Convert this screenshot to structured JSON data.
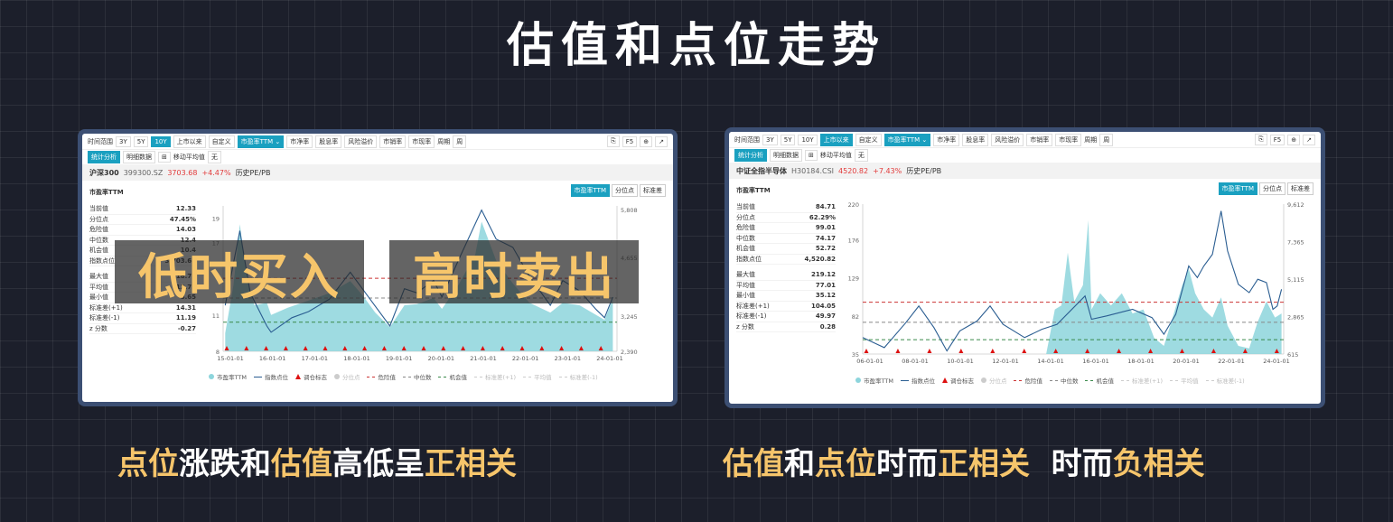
{
  "title": "估值和点位走势",
  "captions": {
    "left": [
      {
        "text": "点位",
        "hl": true
      },
      {
        "text": "涨跌和",
        "hl": false
      },
      {
        "text": "估值",
        "hl": true
      },
      {
        "text": "高低呈",
        "hl": false
      },
      {
        "text": "正相关",
        "hl": true
      }
    ],
    "right": [
      {
        "text": "估值",
        "hl": true
      },
      {
        "text": "和",
        "hl": false
      },
      {
        "text": "点位",
        "hl": true
      },
      {
        "text": "时而",
        "hl": false
      },
      {
        "text": "正相关",
        "hl": true
      },
      {
        "text": "  时而",
        "hl": false
      },
      {
        "text": "负相关",
        "hl": true
      }
    ]
  },
  "overlay": {
    "buy": "低时买入",
    "sell": "高时卖出"
  },
  "colors": {
    "accent": "#1aa0c0",
    "area": "#8dd5dc",
    "line": "#2a5d91",
    "danger": "#c33",
    "opportunity": "#3a8a4a",
    "highlight": "#f6c56b"
  },
  "panels": [
    {
      "toolbar": {
        "time_label": "时间范围",
        "ranges": [
          "3Y",
          "5Y",
          "10Y",
          "上市以来",
          "自定义"
        ],
        "active_range": "10Y",
        "metric": "市盈率TTM",
        "items": [
          "市净率",
          "股息率",
          "风险溢价",
          "市销率",
          "市现率"
        ],
        "period_label": "周期",
        "period_value": "周",
        "f5": "F5"
      },
      "toolbar2": {
        "tab_active": "统计分析",
        "tab_other": "明细数据",
        "ma_label": "移动平均值",
        "ma_value": "无"
      },
      "info": {
        "name": "沪深300",
        "code": "399300.SZ",
        "price": "3703.68",
        "change": "+4.47%",
        "type": "历史PE/PB"
      },
      "chart_title": "市盈率TTM",
      "tabs": [
        "市盈率TTM",
        "分位点",
        "标准差"
      ],
      "stats_top": [
        {
          "label": "当前值",
          "value": "12.33"
        },
        {
          "label": "分位点",
          "value": "47.45%"
        },
        {
          "label": "危险值",
          "value": "14.03"
        },
        {
          "label": "中位数",
          "value": "12.4"
        },
        {
          "label": "机会值",
          "value": "10.4"
        },
        {
          "label": "指数点位",
          "value": "3,703.68"
        }
      ],
      "stats_bottom": [
        {
          "label": "最大值",
          "value": "18.78"
        },
        {
          "label": "平均值",
          "value": "12.75"
        },
        {
          "label": "最小值",
          "value": "8.65"
        },
        {
          "label": "标准差(+1)",
          "value": "14.31"
        },
        {
          "label": "标准差(-1)",
          "value": "11.19"
        },
        {
          "label": "z 分数",
          "value": "-0.27"
        }
      ],
      "legend": [
        {
          "label": "市盈率TTM",
          "type": "dot",
          "color": "#8dd5dc"
        },
        {
          "label": "指数点位",
          "type": "line",
          "color": "#2a5d91"
        },
        {
          "label": "调仓标志",
          "type": "tri",
          "color": "#d11"
        },
        {
          "label": "分位点",
          "type": "dot",
          "color": "#ccc",
          "dim": true
        },
        {
          "label": "危险值",
          "type": "dash",
          "color": "#c33"
        },
        {
          "label": "中位数",
          "type": "dash",
          "color": "#888"
        },
        {
          "label": "机会值",
          "type": "dash",
          "color": "#3a8a4a"
        },
        {
          "label": "标准差(+1)",
          "type": "dash",
          "color": "#ccc",
          "dim": true
        },
        {
          "label": "平均值",
          "type": "dash",
          "color": "#ccc",
          "dim": true
        },
        {
          "label": "标准差(-1)",
          "type": "dash",
          "color": "#ccc",
          "dim": true
        }
      ]
    },
    {
      "toolbar": {
        "time_label": "时间范围",
        "ranges": [
          "3Y",
          "5Y",
          "10Y",
          "上市以来",
          "自定义"
        ],
        "active_range": "上市以来",
        "metric": "市盈率TTM",
        "items": [
          "市净率",
          "股息率",
          "风险溢价",
          "市销率",
          "市现率"
        ],
        "period_label": "周期",
        "period_value": "周",
        "f5": "F5"
      },
      "toolbar2": {
        "tab_active": "统计分析",
        "tab_other": "明细数据",
        "ma_label": "移动平均值",
        "ma_value": "无"
      },
      "info": {
        "name": "中证全指半导体",
        "code": "H30184.CSI",
        "price": "4520.82",
        "change": "+7.43%",
        "type": "历史PE/PB"
      },
      "chart_title": "市盈率TTM",
      "tabs": [
        "市盈率TTM",
        "分位点",
        "标准差"
      ],
      "stats_top": [
        {
          "label": "当前值",
          "value": "84.71"
        },
        {
          "label": "分位点",
          "value": "62.29%"
        },
        {
          "label": "危险值",
          "value": "99.01"
        },
        {
          "label": "中位数",
          "value": "74.17"
        },
        {
          "label": "机会值",
          "value": "52.72"
        },
        {
          "label": "指数点位",
          "value": "4,520.82"
        }
      ],
      "stats_bottom": [
        {
          "label": "最大值",
          "value": "219.12"
        },
        {
          "label": "平均值",
          "value": "77.01"
        },
        {
          "label": "最小值",
          "value": "35.12"
        },
        {
          "label": "标准差(+1)",
          "value": "104.05"
        },
        {
          "label": "标准差(-1)",
          "value": "49.97"
        },
        {
          "label": "z 分数",
          "value": "0.28"
        }
      ],
      "legend": [
        {
          "label": "市盈率TTM",
          "type": "dot",
          "color": "#8dd5dc"
        },
        {
          "label": "指数点位",
          "type": "line",
          "color": "#2a5d91"
        },
        {
          "label": "调仓标志",
          "type": "tri",
          "color": "#d11"
        },
        {
          "label": "分位点",
          "type": "dot",
          "color": "#ccc",
          "dim": true
        },
        {
          "label": "危险值",
          "type": "dash",
          "color": "#c33"
        },
        {
          "label": "中位数",
          "type": "dash",
          "color": "#888"
        },
        {
          "label": "机会值",
          "type": "dash",
          "color": "#3a8a4a"
        },
        {
          "label": "标准差(+1)",
          "type": "dash",
          "color": "#ccc",
          "dim": true
        },
        {
          "label": "平均值",
          "type": "dash",
          "color": "#ccc",
          "dim": true
        },
        {
          "label": "标准差(-1)",
          "type": "dash",
          "color": "#ccc",
          "dim": true
        }
      ]
    }
  ],
  "chart_data": [
    {
      "type": "area",
      "x": [
        "15-01-01",
        "16-01-01",
        "17-01-01",
        "18-01-01",
        "19-01-01",
        "20-01-01",
        "21-01-01",
        "22-01-01",
        "23-01-01",
        "24-01-01"
      ],
      "left_axis_ticks": [
        "19",
        "17",
        "11",
        "8"
      ],
      "right_axis_ticks": [
        "5,808",
        "4,655",
        "3,245",
        "2,390"
      ],
      "pe_points": [
        [
          2015.0,
          9.5
        ],
        [
          2015.2,
          13.5
        ],
        [
          2015.35,
          18.5
        ],
        [
          2015.5,
          14.5
        ],
        [
          2015.7,
          11.8
        ],
        [
          2016.0,
          12.0
        ],
        [
          2016.1,
          11.0
        ],
        [
          2016.5,
          11.6
        ],
        [
          2017.0,
          12.2
        ],
        [
          2017.5,
          12.8
        ],
        [
          2018.0,
          13.8
        ],
        [
          2018.3,
          12.6
        ],
        [
          2018.6,
          11.2
        ],
        [
          2018.95,
          10.0
        ],
        [
          2019.3,
          11.8
        ],
        [
          2019.6,
          11.9
        ],
        [
          2020.0,
          12.4
        ],
        [
          2020.2,
          11.5
        ],
        [
          2020.6,
          13.5
        ],
        [
          2021.0,
          16.0
        ],
        [
          2021.15,
          18.7
        ],
        [
          2021.5,
          15.5
        ],
        [
          2021.9,
          13.6
        ],
        [
          2022.3,
          12.0
        ],
        [
          2022.8,
          11.2
        ],
        [
          2023.1,
          12.0
        ],
        [
          2023.5,
          11.8
        ],
        [
          2023.9,
          11.0
        ],
        [
          2024.1,
          10.6
        ],
        [
          2024.3,
          12.3
        ]
      ],
      "index_points": [
        [
          2015.0,
          3500
        ],
        [
          2015.35,
          5300
        ],
        [
          2015.6,
          3800
        ],
        [
          2016.0,
          3000
        ],
        [
          2016.1,
          2850
        ],
        [
          2016.6,
          3200
        ],
        [
          2017.0,
          3350
        ],
        [
          2017.5,
          3650
        ],
        [
          2018.0,
          4300
        ],
        [
          2018.4,
          3750
        ],
        [
          2018.95,
          3000
        ],
        [
          2019.3,
          3900
        ],
        [
          2019.6,
          3800
        ],
        [
          2020.0,
          4100
        ],
        [
          2020.2,
          3700
        ],
        [
          2020.6,
          4600
        ],
        [
          2021.15,
          5800
        ],
        [
          2021.5,
          5100
        ],
        [
          2021.9,
          4900
        ],
        [
          2022.3,
          4200
        ],
        [
          2022.8,
          3500
        ],
        [
          2023.1,
          4100
        ],
        [
          2023.5,
          3850
        ],
        [
          2023.9,
          3400
        ],
        [
          2024.1,
          3200
        ],
        [
          2024.3,
          3700
        ]
      ],
      "danger": 14.03,
      "median": 12.4,
      "opportunity": 10.4,
      "left_ylim": [
        8,
        20
      ],
      "right_ylim": [
        2390,
        5900
      ],
      "xlim": [
        2014.95,
        2024.4
      ]
    },
    {
      "type": "area",
      "x": [
        "06-01-01",
        "08-01-01",
        "10-01-01",
        "12-01-01",
        "14-01-01",
        "16-01-01",
        "18-01-01",
        "20-01-01",
        "22-01-01",
        "24-01-01"
      ],
      "left_axis_ticks": [
        "220",
        "176",
        "129",
        "82",
        "35"
      ],
      "right_axis_ticks": [
        "9,612",
        "7,365",
        "5,115",
        "2,865",
        "615"
      ],
      "pe_points": [
        [
          2013.5,
          35
        ],
        [
          2013.9,
          90
        ],
        [
          2014.2,
          95
        ],
        [
          2014.5,
          160
        ],
        [
          2014.8,
          100
        ],
        [
          2015.2,
          120
        ],
        [
          2015.45,
          200
        ],
        [
          2015.6,
          90
        ],
        [
          2016.0,
          110
        ],
        [
          2016.5,
          95
        ],
        [
          2017.0,
          110
        ],
        [
          2017.5,
          85
        ],
        [
          2018.0,
          90
        ],
        [
          2018.5,
          55
        ],
        [
          2018.95,
          45
        ],
        [
          2019.3,
          75
        ],
        [
          2019.8,
          120
        ],
        [
          2020.1,
          140
        ],
        [
          2020.4,
          110
        ],
        [
          2020.8,
          90
        ],
        [
          2021.2,
          80
        ],
        [
          2021.6,
          105
        ],
        [
          2021.9,
          70
        ],
        [
          2022.4,
          45
        ],
        [
          2022.9,
          42
        ],
        [
          2023.3,
          75
        ],
        [
          2023.7,
          100
        ],
        [
          2024.1,
          80
        ],
        [
          2024.4,
          85
        ]
      ],
      "index_points": [
        [
          2005.0,
          1600
        ],
        [
          2006.0,
          1000
        ],
        [
          2007.0,
          2500
        ],
        [
          2007.6,
          3500
        ],
        [
          2008.3,
          2200
        ],
        [
          2008.9,
          800
        ],
        [
          2009.5,
          2000
        ],
        [
          2010.3,
          2600
        ],
        [
          2010.9,
          3500
        ],
        [
          2011.5,
          2400
        ],
        [
          2012.5,
          1600
        ],
        [
          2013.3,
          2100
        ],
        [
          2014.0,
          2400
        ],
        [
          2015.3,
          4100
        ],
        [
          2015.6,
          2700
        ],
        [
          2016.3,
          2900
        ],
        [
          2017.5,
          3300
        ],
        [
          2018.4,
          2800
        ],
        [
          2018.95,
          1800
        ],
        [
          2019.5,
          3000
        ],
        [
          2020.1,
          5900
        ],
        [
          2020.5,
          5200
        ],
        [
          2020.8,
          5900
        ],
        [
          2021.2,
          6600
        ],
        [
          2021.6,
          9200
        ],
        [
          2021.9,
          6800
        ],
        [
          2022.4,
          4800
        ],
        [
          2022.9,
          4300
        ],
        [
          2023.3,
          5100
        ],
        [
          2023.7,
          4900
        ],
        [
          2024.0,
          3300
        ],
        [
          2024.2,
          3500
        ],
        [
          2024.4,
          4500
        ]
      ],
      "danger": 99.01,
      "median": 74.17,
      "opportunity": 52.72,
      "left_ylim": [
        35,
        220
      ],
      "right_ylim": [
        615,
        9612
      ],
      "xlim": [
        2005.0,
        2024.5
      ]
    }
  ]
}
